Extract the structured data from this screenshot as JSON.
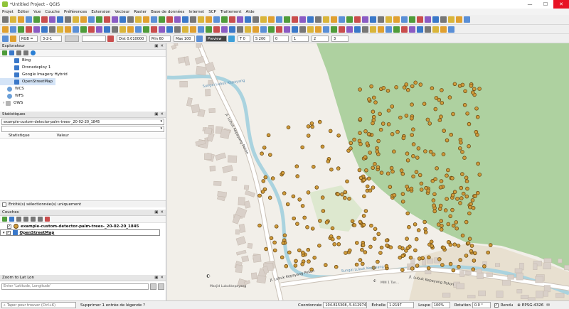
{
  "window": {
    "title": "*Untitled Project - QGIS"
  },
  "menu": [
    "Projet",
    "Éditer",
    "Vue",
    "Couche",
    "Préférences",
    "Extension",
    "Vecteur",
    "Raster",
    "Base de données",
    "Internet",
    "SCP",
    "Traitement",
    "Aide"
  ],
  "toolbar3": {
    "rgb_label": "RGB =",
    "band_value": "3-2-1",
    "dist_label": "Dist 0.010000",
    "min_label": "Min 60",
    "max_label": "Max 100",
    "preview_label": "Preview",
    "t_value": "T 0",
    "s_value": "S 200",
    "n0": "0",
    "n1": "1",
    "n2": "2",
    "n3": "3"
  },
  "explorer": {
    "title": "Explorateur",
    "items": [
      "Bing",
      "Dronedeploy 1",
      "Google Imagery Hybrid",
      "OpenStreetMap",
      "WCS",
      "WFS",
      "OWS"
    ]
  },
  "statistics": {
    "title": "Statistiques",
    "layer_select": "example-custom-detector-palm-trees-_20-02-20_1845",
    "col_stat": "Statistique",
    "col_value": "Valeur",
    "selected_only": "Entité(s) sélectionnée(s) uniquement"
  },
  "layers": {
    "title": "Couches",
    "items": [
      "example-custom-detector-palm-trees-_20-02-20_1845",
      "OpenStreetMap"
    ]
  },
  "zoom": {
    "title": "Zoom to Lat Lon",
    "placeholder": "Enter 'Latitude, Longitude'"
  },
  "map_labels": {
    "stream1": "Sungai Lubuk Kepayang",
    "stream2": "Sungai Lubuk Kepayang",
    "road1": "Jl. Lubuk Kepayang Pekon",
    "road2": "Jl. Lubuk Kepayang Pekon",
    "road3": "Jl. Lubuk Kepayang Pekon",
    "poi1": "Masjid Lubukkepayang",
    "poi2": "MIN 1 Tan..."
  },
  "status": {
    "search_placeholder": "Taper pour trouver (Ctrl+K)",
    "message": "Supprimer 1 entrée de légende ?",
    "coord_label": "Coordonnée",
    "coord_value": "104.815308,-5.412974",
    "scale_label": "Échelle",
    "scale_value": "1:2197",
    "magnifier_label": "Loupe",
    "magnifier_value": "100%",
    "rotation_label": "Rotation",
    "rotation_value": "0.0 °",
    "render_label": "Rendu",
    "crs": "EPSG:4326"
  },
  "colors": {
    "forest": "#aed1a0",
    "palm": "#d09b3a",
    "palm_outline": "#6b4a14",
    "river": "#aad3df",
    "building": "#d9d0c9",
    "road": "#ffffff",
    "map_bg": "#f2efe9"
  }
}
